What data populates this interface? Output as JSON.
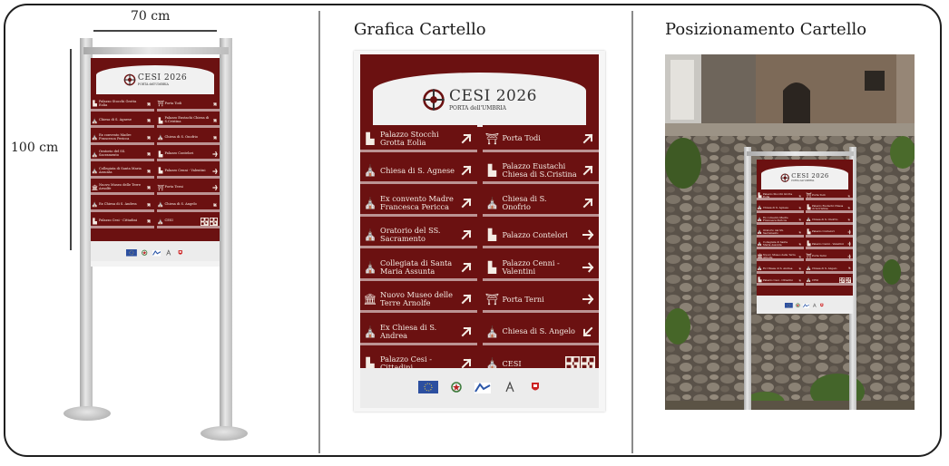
{
  "panels": {
    "dimensions": {
      "width_label": "70 cm",
      "height_label": "100 cm"
    },
    "graphic": {
      "title": "Grafica Cartello"
    },
    "placement": {
      "title": "Posizionamento Cartello"
    }
  },
  "sign": {
    "logo": {
      "name": "CESI 2026",
      "subtitle": "PORTA dell'UMBRIA"
    },
    "left_column": [
      {
        "label": "Palazzo Stocchi Grotta Eolia",
        "icon": "building-icon",
        "arrow": "arrow-up-right"
      },
      {
        "label": "Chiesa di S. Agnese",
        "icon": "church-icon",
        "arrow": "arrow-up-right"
      },
      {
        "label": "Ex convento Madre Francesca Pericca",
        "icon": "church-icon",
        "arrow": "arrow-up-right"
      },
      {
        "label": "Oratorio del SS. Sacramento",
        "icon": "church-icon",
        "arrow": "arrow-up-right"
      },
      {
        "label": "Collegiata di Santa Maria Assunta",
        "icon": "church-icon",
        "arrow": "arrow-up-right"
      },
      {
        "label": "Nuovo Museo delle Terre Arnolfe",
        "icon": "museum-icon",
        "arrow": "arrow-up-right"
      },
      {
        "label": "Ex Chiesa di S. Andrea",
        "icon": "church-icon",
        "arrow": "arrow-up-right"
      },
      {
        "label": "Palazzo Cesi - Cittadini",
        "icon": "building-icon",
        "arrow": "arrow-up-right"
      }
    ],
    "right_column": [
      {
        "label": "Porta Todi",
        "icon": "gate-icon",
        "arrow": "arrow-up-right"
      },
      {
        "label": "Palazzo Eustachi Chiesa di S.Cristina",
        "icon": "building-icon",
        "arrow": "arrow-up-right"
      },
      {
        "label": "Chiesa di S. Onofrio",
        "icon": "church-icon",
        "arrow": "arrow-up-right"
      },
      {
        "label": "Palazzo Contelori",
        "icon": "building-icon",
        "arrow": "arrow-right"
      },
      {
        "label": "Palazzo Cenni - Valentini",
        "icon": "building-icon",
        "arrow": "arrow-right"
      },
      {
        "label": "Porta Terni",
        "icon": "gate-icon",
        "arrow": "arrow-right"
      },
      {
        "label": "Chiesa di S. Angelo",
        "icon": "church-icon",
        "arrow": "arrow-down-left"
      },
      {
        "label": "CESI",
        "icon": "church-icon",
        "arrow": "qr-codes"
      }
    ],
    "colors": {
      "plate": "#6b1111",
      "header": "#f1f1f1",
      "text": "#f4ece4"
    },
    "footer_logos": [
      "eu-flag-logo",
      "italy-emblem-logo",
      "region-logo",
      "ministry-logo",
      "comune-logo"
    ]
  }
}
